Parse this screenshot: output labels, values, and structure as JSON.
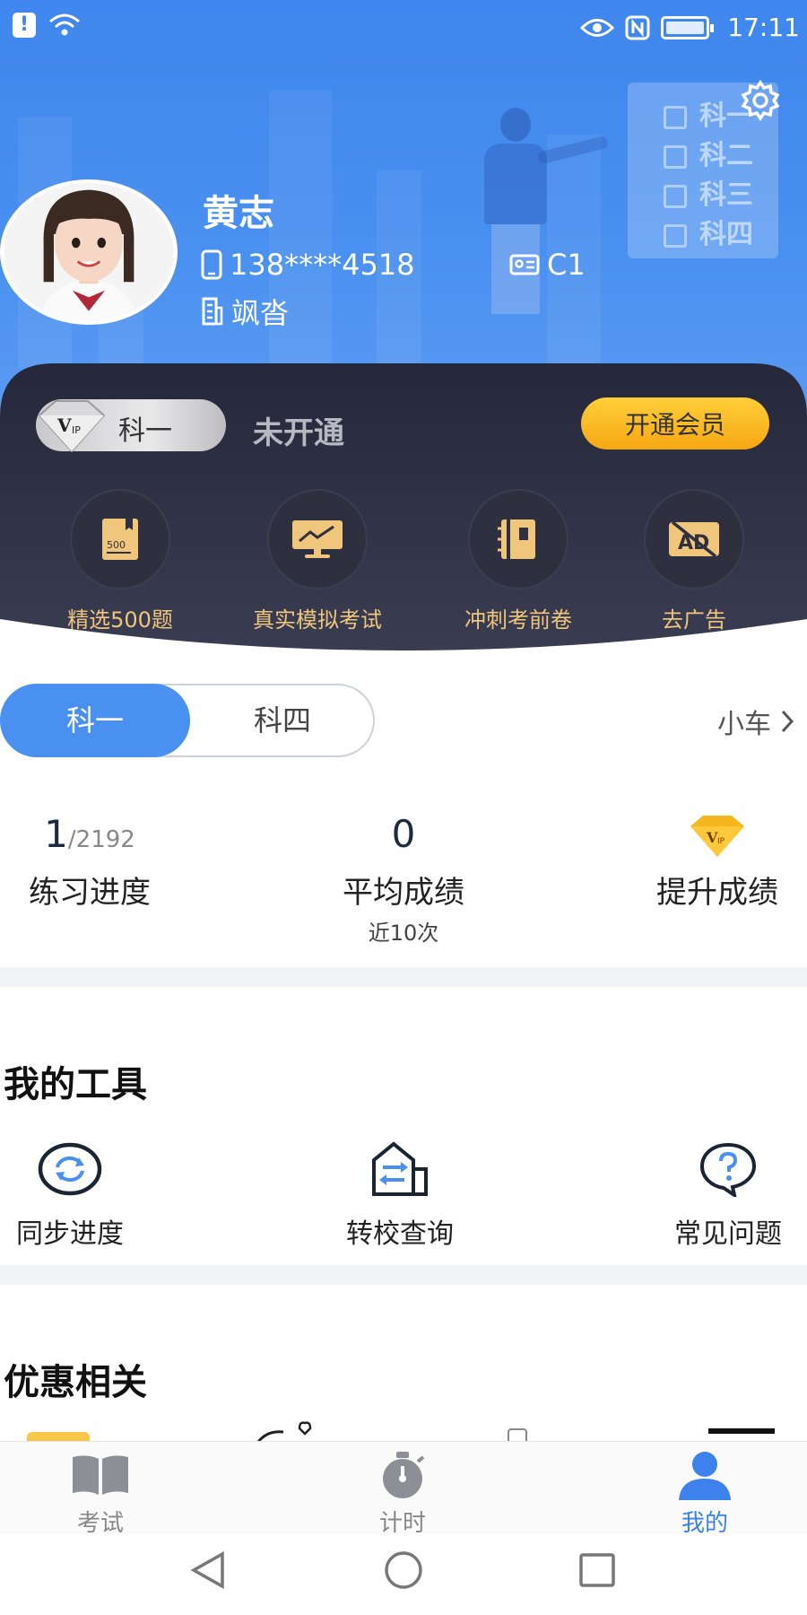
{
  "status_bar": {
    "time": "17:11"
  },
  "illustration": {
    "items": [
      "科一",
      "科二",
      "科三",
      "科四"
    ]
  },
  "profile": {
    "name": "黄志",
    "phone": "138****4518",
    "license": "C1",
    "region": "飒沓"
  },
  "vip": {
    "badge_label": "科一",
    "status": "未开通",
    "open_button": "开通会员",
    "features": [
      {
        "label": "精选500题",
        "icon": "book-500-icon"
      },
      {
        "label": "真实模拟考试",
        "icon": "monitor-exam-icon"
      },
      {
        "label": "冲刺考前卷",
        "icon": "notebook-icon"
      },
      {
        "label": "去广告",
        "icon": "no-ad-icon"
      }
    ],
    "feature_icon_text": {
      "book": "500",
      "ad": "AD"
    }
  },
  "subjects": {
    "tabs": [
      "科一",
      "科四"
    ],
    "active": "科一",
    "vehicle": "小车"
  },
  "stats": {
    "progress": {
      "value": "1",
      "total": "/2192",
      "label": "练习进度"
    },
    "average": {
      "value": "0",
      "label": "平均成绩",
      "sub": "近10次"
    },
    "improve": {
      "label": "提升成绩"
    }
  },
  "tools": {
    "title": "我的工具",
    "items": [
      {
        "label": "同步进度",
        "icon": "sync-icon"
      },
      {
        "label": "转校查询",
        "icon": "school-transfer-icon"
      },
      {
        "label": "常见问题",
        "icon": "faq-icon"
      }
    ]
  },
  "promos": {
    "title": "优惠相关"
  },
  "tabbar": {
    "items": [
      {
        "label": "考试",
        "icon": "book-icon"
      },
      {
        "label": "计时",
        "icon": "stopwatch-icon"
      },
      {
        "label": "我的",
        "icon": "person-icon"
      }
    ],
    "active": "我的"
  },
  "colors": {
    "primary": "#4a90f0",
    "vip_dark": "#262838",
    "vip_gold": "#f0c57c",
    "vip_button": "#f6a712"
  }
}
